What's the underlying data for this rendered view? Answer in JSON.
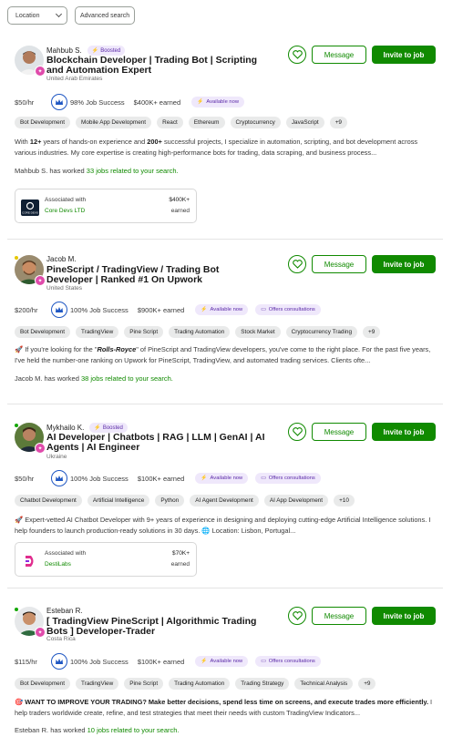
{
  "filters": {
    "location_label": "Location",
    "advanced_label": "Advanced search"
  },
  "labels": {
    "message": "Message",
    "invite": "Invite to job",
    "boosted": "Boosted",
    "job_success_suffix": "Job Success",
    "available_now": "Available now",
    "offers_consultations": "Offers consultations",
    "associated_with": "Associated with",
    "earned": "earned"
  },
  "freelancers": [
    {
      "name": "Mahbub S.",
      "title": "Blockchain Developer | Trading Bot | Scripting and Automation Expert",
      "country": "United Arab Emirates",
      "rate": "$50/hr",
      "job_success": "98%",
      "earned": "$400K+ earned",
      "skills": [
        "Bot Development",
        "Mobile App Development",
        "React",
        "Ethereum",
        "Cryptocurrency",
        "JavaScript",
        "+9"
      ],
      "desc_pre": "With ",
      "desc_b1": "12+",
      "desc_mid": " years of hands-on experience and ",
      "desc_b2": "200+",
      "desc_post": " successful projects, I specialize in automation, scripting, and bot development across various industries. My core expertise is creating high-performance bots for trading, data scraping, and business process...",
      "worked_prefix": "Mahbub S. has worked ",
      "worked_link": "33 jobs related to your search.",
      "assoc_company": "Core Devs LTD",
      "assoc_logo_text": "CORE DEVS",
      "assoc_amount": "$400K+"
    },
    {
      "name": "Jacob M.",
      "title": "PineScript / TradingView / Trading Bot Developer | Ranked #1 On Upwork",
      "country": "United States",
      "rate": "$200/hr",
      "job_success": "100%",
      "earned": "$900K+ earned",
      "skills": [
        "Bot Development",
        "TradingView",
        "Pine Script",
        "Trading Automation",
        "Stock Market",
        "Cryptocurrency Trading",
        "+9"
      ],
      "desc_emoji": "🚀",
      "desc_pre": " If you're looking for the \"",
      "desc_b1": "Rolls-Royce",
      "desc_post": "\" of PineScript and TradingView developers, you've come to the right place. For the past five years, I've held the number-one ranking on Upwork for PineScript, TradingView, and automated trading services. Clients ofte...",
      "worked_prefix": "Jacob M. has worked ",
      "worked_link": "38 jobs related to your search."
    },
    {
      "name": "Mykhailo K.",
      "title": "AI Developer | Chatbots | RAG | LLM | GenAI | AI Agents | AI Engineer",
      "country": "Ukraine",
      "rate": "$50/hr",
      "job_success": "100%",
      "earned": "$100K+ earned",
      "skills": [
        "Chatbot Development",
        "Artificial Intelligence",
        "Python",
        "AI Agent Development",
        "AI App Development",
        "+10"
      ],
      "desc_emoji": "🚀",
      "desc_post": " Expert-vetted AI Chatbot Developer with 9+ years of experience in designing and deploying cutting-edge Artificial Intelligence solutions. I help founders to launch production-ready solutions in 30 days. 🌐 Location: Lisbon, Portugal...",
      "assoc_company": "DestiLabs",
      "assoc_amount": "$70K+"
    },
    {
      "name": "Esteban R.",
      "title": "[ TradingView PineScript | Algorithmic Trading Bots ] Developer-Trader",
      "country": "Costa Rica",
      "rate": "$115/hr",
      "job_success": "100%",
      "earned": "$100K+ earned",
      "skills": [
        "Bot Development",
        "TradingView",
        "Pine Script",
        "Trading Automation",
        "Trading Strategy",
        "Technical Analysis",
        "+9"
      ],
      "desc_emoji": "🎯",
      "desc_b1": " WANT TO IMPROVE YOUR TRADING? Make better decisions, spend less time on screens, and execute trades more efficiently.",
      "desc_post": " I help traders worldwide create, refine, and test strategies that meet their needs with custom TradingView Indicators...",
      "worked_prefix": "Esteban R. has worked ",
      "worked_link": "10 jobs related to your search."
    }
  ],
  "colors": {
    "primary_green": "#108a00",
    "boost_purple": "#5b2aa8",
    "job_success_blue": "#1f57c3"
  }
}
